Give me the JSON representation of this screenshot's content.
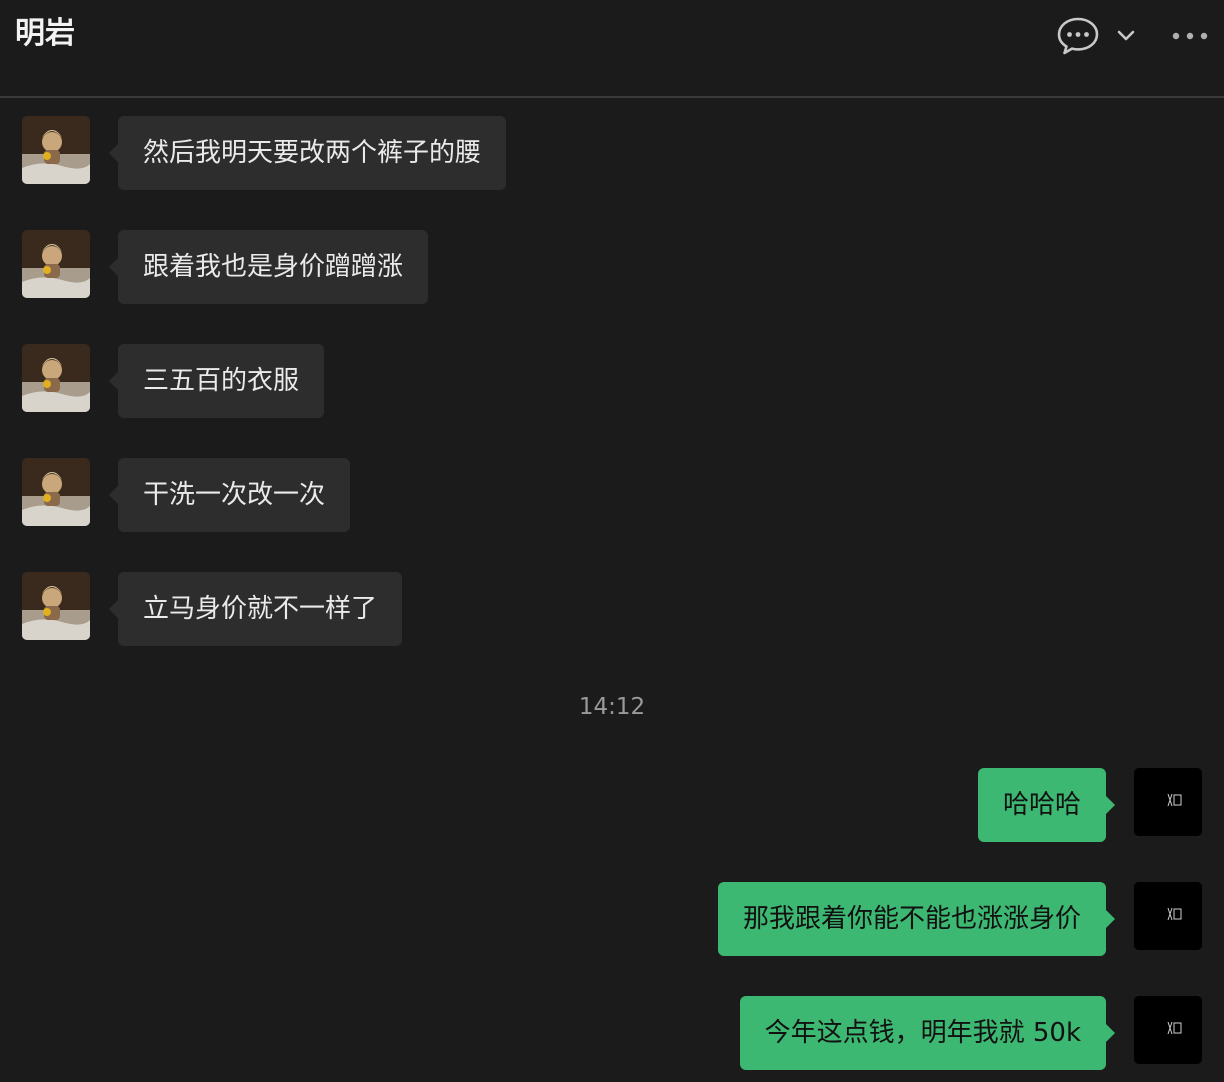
{
  "header": {
    "title": "明岩",
    "icons": [
      "chat-bubble-icon",
      "chevron-down-icon",
      "more-icon"
    ]
  },
  "messages_left": [
    {
      "text": "然后我明天要改两个裤子的腰"
    },
    {
      "text": "跟着我也是身价蹭蹭涨"
    },
    {
      "text": "三五百的衣服"
    },
    {
      "text": "干洗一次改一次"
    },
    {
      "text": "立马身价就不一样了"
    }
  ],
  "timestamp": "14:12",
  "messages_right": [
    {
      "text": "哈哈哈"
    },
    {
      "text": "那我跟着你能不能也涨涨身价"
    },
    {
      "text": "今年这点钱，明年我就 50k"
    }
  ],
  "colors": {
    "background": "#1b1b1b",
    "incoming_bubble": "#2d2d2d",
    "outgoing_bubble": "#3db873",
    "divider": "#3a3a3a"
  }
}
